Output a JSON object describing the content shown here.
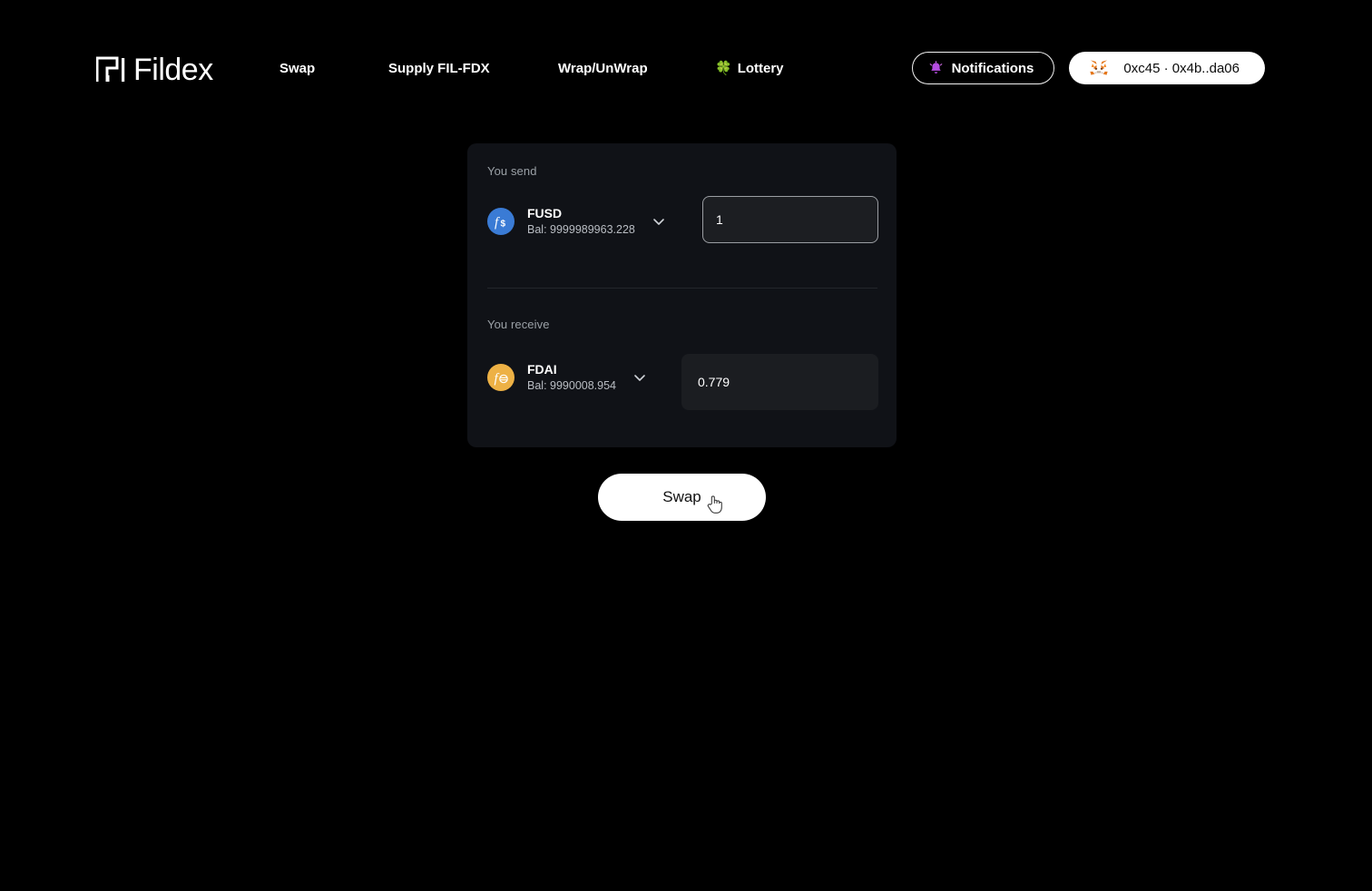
{
  "header": {
    "brand": {
      "name": "Fildex",
      "mark_icon": "fildex-logo-mark"
    },
    "nav": [
      {
        "id": "swap",
        "label": "Swap"
      },
      {
        "id": "supply",
        "label": "Supply FIL-FDX"
      },
      {
        "id": "wrap",
        "label": "Wrap/UnWrap"
      },
      {
        "id": "lottery",
        "label": "Lottery",
        "emoji": "🍀"
      }
    ],
    "notifications": {
      "label": "Notifications",
      "icon": "bell-icon"
    },
    "wallet": {
      "label": "0xc45 · 0x4b..da06",
      "icon": "metamask-fox-icon"
    }
  },
  "swap_card": {
    "send": {
      "label": "You send",
      "token_symbol": "FUSD",
      "token_balance": "Bal: 9999989963.228",
      "token_icon": "fusd-token-icon",
      "token_icon_color": "#3a7bd5",
      "amount": "1",
      "placeholder": "0.0"
    },
    "receive": {
      "label": "You receive",
      "token_symbol": "FDAI",
      "token_balance": "Bal: 9990008.954",
      "token_icon": "fdai-token-icon",
      "token_icon_color": "#edb145",
      "amount": "0.779"
    }
  },
  "actions": {
    "swap_label": "Swap"
  },
  "theme": {
    "page_background": "#000000",
    "card_background": "#101217",
    "accent_white": "#ffffff",
    "muted_text": "#9aa0a6"
  }
}
